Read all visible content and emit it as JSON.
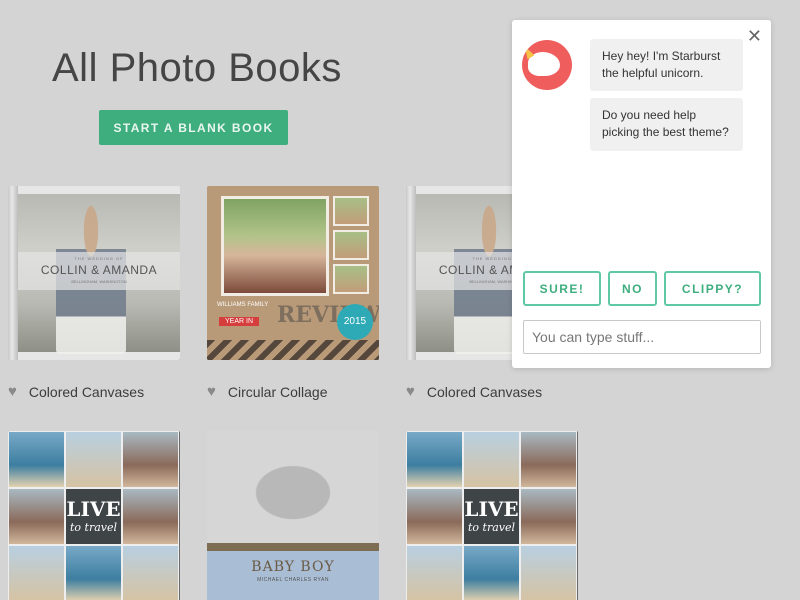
{
  "header": {
    "title": "All Photo Books",
    "start_button": "START A BLANK BOOK"
  },
  "books": [
    {
      "label": "Colored Canvases",
      "cover_small": "THE WEDDING OF",
      "cover_title": "COLLIN & AMANDA",
      "cover_place": "BELLINGHAM, WASHINGTON"
    },
    {
      "label": "Circular Collage",
      "cover_banner": "WILLIAMS FAMILY",
      "cover_ribbon": "YEAR IN",
      "cover_title": "REVIEW",
      "cover_year": "2015"
    },
    {
      "label": "Colored Canvases",
      "cover_small": "THE WEDDING OF",
      "cover_title": "COLLIN & AMANDA",
      "cover_place": "BELLINGHAM, WASHINGTON"
    },
    {
      "cover_title": "LIVE",
      "cover_sub": "to travel"
    },
    {
      "cover_title": "BABY BOY",
      "cover_name": "MICHAEL CHARLES RYAN"
    },
    {
      "cover_title": "LIVE",
      "cover_sub": "to travel"
    }
  ],
  "chat": {
    "messages": [
      "Hey hey! I'm Starburst the helpful unicorn.",
      "Do you need help picking the best theme?"
    ],
    "choices": [
      "SURE!",
      "NO",
      "CLIPPY?"
    ],
    "input_placeholder": "You can type stuff...",
    "close_icon": "close-icon",
    "avatar_icon": "unicorn-icon"
  },
  "colors": {
    "accent": "#3fae7f",
    "choice_border": "#5fc9a5",
    "avatar_bg": "#ef5d5d"
  }
}
